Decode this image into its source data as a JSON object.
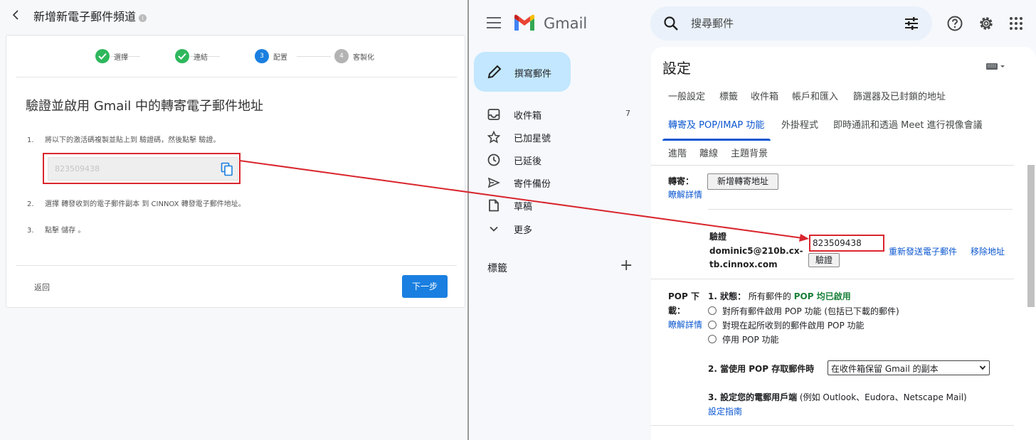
{
  "left": {
    "header_title": "新增新電子郵件頻道",
    "info_icon": "i",
    "steps": [
      {
        "label": "選擇",
        "state": "done"
      },
      {
        "label": "連結",
        "state": "done"
      },
      {
        "label": "配置",
        "state": "active",
        "number": "3"
      },
      {
        "label": "客製化",
        "state": "todo",
        "number": "4"
      }
    ],
    "title": "驗證並啟用 Gmail 中的轉寄電子郵件地址",
    "instructions": [
      {
        "num": "1.",
        "text": "將以下的激活碼複製並貼上到 驗證碼，然後點擊 驗證。"
      },
      {
        "num": "2.",
        "text": "選擇 轉發收到的電子郵件副本 到 CINNOX 轉發電子郵件地址。"
      },
      {
        "num": "3.",
        "text": "點擊 儲存 。"
      }
    ],
    "code": "823509438",
    "back_label": "返回",
    "next_label": "下一步",
    "highlight_color": "#d9262e"
  },
  "gmail": {
    "brand": "Gmail",
    "search_placeholder": "搜尋郵件",
    "compose_label": "撰寫郵件",
    "nav": [
      {
        "label": "收件箱",
        "icon": "inbox-icon",
        "count": "7"
      },
      {
        "label": "已加星號",
        "icon": "star-icon",
        "count": ""
      },
      {
        "label": "已延後",
        "icon": "clock-icon",
        "count": ""
      },
      {
        "label": "寄件備份",
        "icon": "send-icon",
        "count": ""
      },
      {
        "label": "草稿",
        "icon": "draft-icon",
        "count": ""
      },
      {
        "label": "更多",
        "icon": "chevron-down-icon",
        "count": ""
      }
    ],
    "labels_title": "標籤",
    "labels_add": "+",
    "settings": {
      "title": "設定",
      "tabs_row1": [
        "一般設定",
        "標籤",
        "收件箱",
        "帳戶和匯入",
        "篩選器及已封鎖的地址"
      ],
      "tabs_row2": [
        "轉寄及 POP/IMAP 功能",
        "外掛程式",
        "即時通訊和透過 Meet 進行視像會議"
      ],
      "tabs_row3": [
        "進階",
        "離線",
        "主題背景"
      ],
      "forward_label": "轉寄：",
      "learn_more": "瞭解詳情",
      "add_forward_btn": "新增轉寄地址",
      "verify_label_1": "驗證",
      "verify_label_2": "dominic5@210b.cx-",
      "verify_label_3": "tb.cinnox.com",
      "verify_code": "823509438",
      "verify_btn": "驗證",
      "resend_link": "重新發送電子郵件",
      "remove_link": "移除地址",
      "pop_label_1": "POP 下",
      "pop_label_2": "載：",
      "pop_learn_more": "瞭解詳情",
      "pop_status_prefix": "1. 狀態：",
      "pop_status_text": "所有郵件的",
      "pop_status_green": "POP 均已啟用",
      "pop_options": [
        "對所有郵件啟用 POP 功能 (包括已下載的郵件)",
        "對現在起所收到的郵件啟用 POP 功能",
        "停用 POP 功能"
      ],
      "pop_access_label": "2. 當使用 POP 存取郵件時",
      "pop_access_value": "在收件箱保留 Gmail 的副本",
      "client_label": "3. 設定您的電郵用戶端",
      "client_text": "(例如 Outlook、Eudora、Netscape Mail)",
      "setup_guide": "設定指南"
    }
  }
}
